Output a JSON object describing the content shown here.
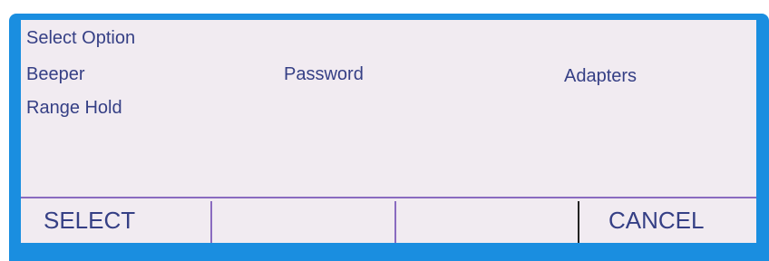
{
  "screen": {
    "title": "Select Option",
    "options": {
      "beeper": "Beeper",
      "password": "Password",
      "adapters": "Adapters",
      "range_hold": "Range Hold"
    }
  },
  "softkeys": {
    "key1": "SELECT",
    "key2": "",
    "key3": "",
    "key4": "CANCEL"
  },
  "colors": {
    "frame": "#1a8ee0",
    "screen_bg": "#f1ebf1",
    "text": "#353f85",
    "divider": "#8a6bc0"
  }
}
